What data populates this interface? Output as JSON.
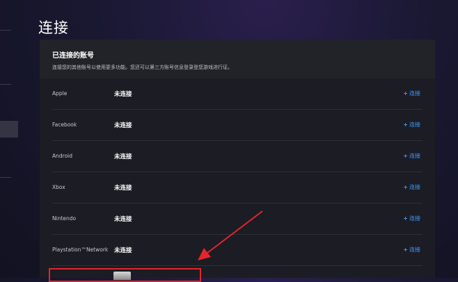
{
  "page": {
    "title": "连接"
  },
  "panel": {
    "title": "已连接的账号",
    "description": "连接您的其他账号以使用更多功能。您还可以第三方账号信息登录登您游戏进行证。"
  },
  "accounts": [
    {
      "provider": "Apple",
      "status": "未连接",
      "action": "连接"
    },
    {
      "provider": "Facebook",
      "status": "未连接",
      "action": "连接"
    },
    {
      "provider": "Android",
      "status": "未连接",
      "action": "连接"
    },
    {
      "provider": "Xbox",
      "status": "未连接",
      "action": "连接"
    },
    {
      "provider": "Nintendo",
      "status": "未连接",
      "action": "连接"
    },
    {
      "provider": "Playstation™Network",
      "status": "未连接",
      "action": "连接"
    }
  ],
  "annotation": {
    "color": "#e2262b"
  },
  "colors": {
    "accent": "#3d9cff",
    "panel_bg": "#1c1c24"
  }
}
